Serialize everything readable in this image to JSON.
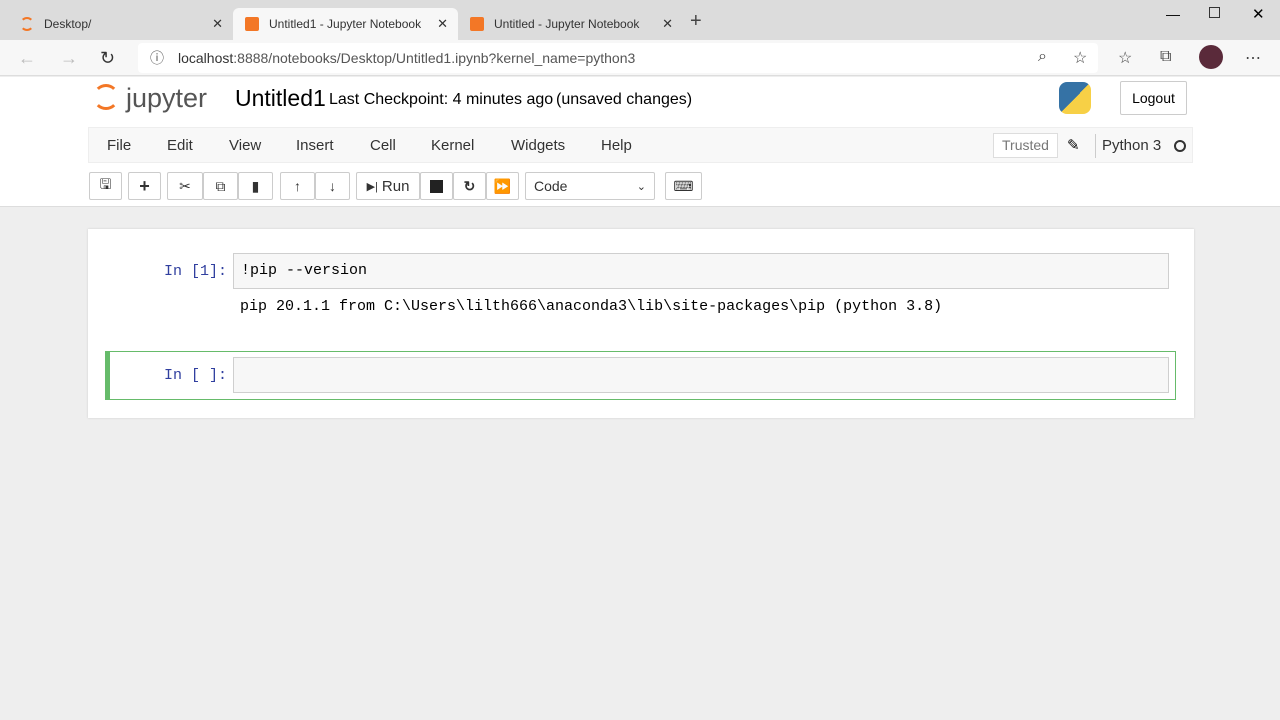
{
  "browser": {
    "tabs": [
      {
        "title": "Desktop/"
      },
      {
        "title": "Untitled1 - Jupyter Notebook"
      },
      {
        "title": "Untitled - Jupyter Notebook"
      }
    ],
    "url_host": "localhost",
    "url_rest": ":8888/notebooks/Desktop/Untitled1.ipynb?kernel_name=python3"
  },
  "header": {
    "logo": "jupyter",
    "title": "Untitled1",
    "checkpoint": "Last Checkpoint: 4 minutes ago",
    "unsaved": "(unsaved changes)",
    "logout": "Logout"
  },
  "menu": {
    "items": [
      "File",
      "Edit",
      "View",
      "Insert",
      "Cell",
      "Kernel",
      "Widgets",
      "Help"
    ],
    "trusted": "Trusted",
    "kernel": "Python 3"
  },
  "toolbar": {
    "run": "Run",
    "cell_type": "Code"
  },
  "cells": [
    {
      "prompt": "In [1]:",
      "source": "!pip --version",
      "output": "pip 20.1.1 from C:\\Users\\lilth666\\anaconda3\\lib\\site-packages\\pip (python 3.8)"
    },
    {
      "prompt": "In [ ]:",
      "source": ""
    }
  ],
  "colors": {
    "accent": "#f37726",
    "selected_cell": "#66bb6a"
  }
}
